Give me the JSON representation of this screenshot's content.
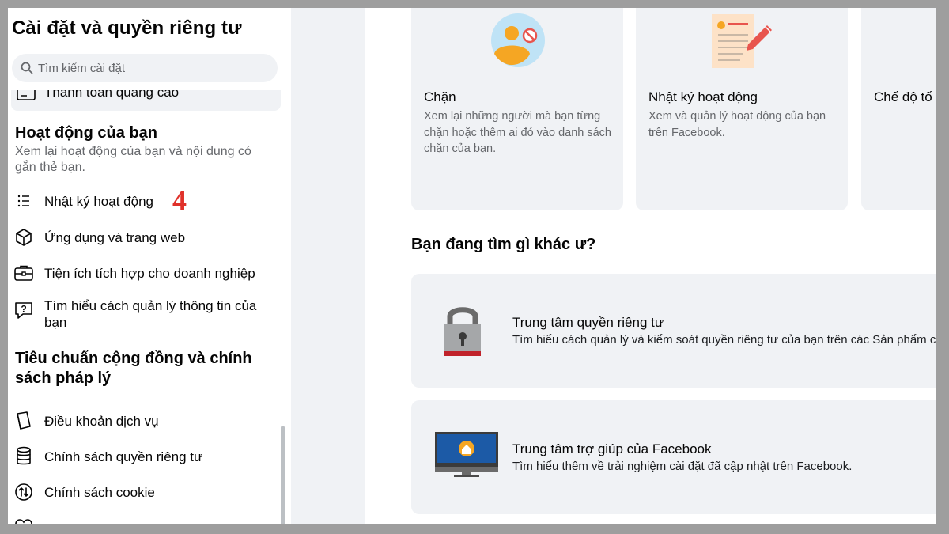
{
  "sidebar": {
    "title": "Cài đặt và quyền riêng tư",
    "search": {
      "placeholder": "Tìm kiếm cài đặt"
    },
    "cut_item": {
      "label": "Thanh toán quảng cáo"
    },
    "activity_section": {
      "heading": "Hoạt động của bạn",
      "description": "Xem lại hoạt động của bạn và nội dung có gắn thẻ bạn.",
      "items": [
        {
          "label": "Nhật ký hoạt động",
          "icon": "list-icon"
        },
        {
          "label": "Ứng dụng và trang web",
          "icon": "cube-icon"
        },
        {
          "label": "Tiện ích tích hợp cho doanh nghiệp",
          "icon": "briefcase-icon"
        },
        {
          "label": "Tìm hiểu cách quản lý thông tin của bạn",
          "icon": "question-bubble-icon"
        }
      ]
    },
    "standards_section": {
      "heading": "Tiêu chuẩn cộng đồng và chính sách pháp lý",
      "items": [
        {
          "label": "Điều khoản dịch vụ",
          "icon": "book-icon"
        },
        {
          "label": "Chính sách quyền riêng tư",
          "icon": "database-icon"
        },
        {
          "label": "Chính sách cookie",
          "icon": "arrows-circle-icon"
        }
      ]
    }
  },
  "annotation": {
    "step_number": "4"
  },
  "main": {
    "cards": [
      {
        "title": "Chặn",
        "description": "Xem lại những người mà bạn từng chặn hoặc thêm ai đó vào danh sách chặn của bạn.",
        "icon": "blocked-person-icon"
      },
      {
        "title": "Nhật ký hoạt động",
        "description": "Xem và quản lý hoạt động của bạn trên Facebook.",
        "icon": "activity-log-document-icon"
      },
      {
        "title": "Chế độ tố",
        "description": "",
        "icon": ""
      }
    ],
    "other_section_title": "Bạn đang tìm gì khác ư?",
    "links": [
      {
        "title": "Trung tâm quyền riêng tư",
        "description": "Tìm hiểu cách quản lý và kiểm soát quyền riêng tư của bạn trên các Sản phẩm c",
        "icon": "padlock-icon"
      },
      {
        "title": "Trung tâm trợ giúp của Facebook",
        "description": "Tìm hiểu thêm về trải nghiệm cài đặt đã cập nhật trên Facebook.",
        "icon": "monitor-home-icon"
      }
    ]
  },
  "colors": {
    "accent_annotation": "#e0312a",
    "panel_bg": "#f0f2f5",
    "frame": "#9e9e9e"
  }
}
